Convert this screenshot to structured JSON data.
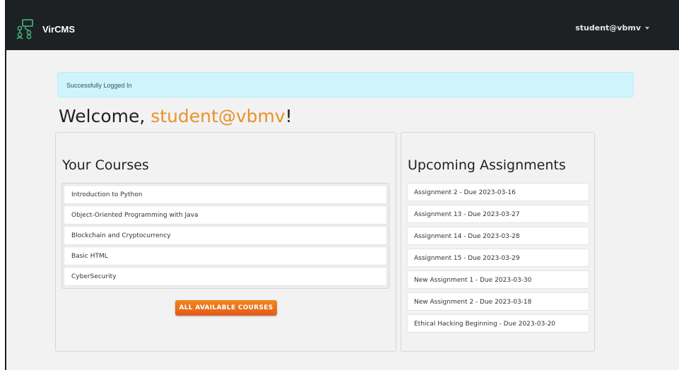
{
  "navbar": {
    "brand": "VirCMS",
    "user": "student@vbmv",
    "logo_icon": "network-nodes-icon"
  },
  "alert": {
    "message": "Successfully Logged In"
  },
  "welcome": {
    "prefix": "Welcome, ",
    "name": "student@vbmv",
    "suffix": "!"
  },
  "courses": {
    "title": "Your Courses",
    "items": [
      "Introduction to Python",
      "Object-Oriented Programming with Java",
      "Blockchain and Cryptocurrency",
      "Basic HTML",
      "CyberSecurity"
    ],
    "button_label": "ALL AVAILABLE COURSES"
  },
  "assignments": {
    "title": "Upcoming Assignments",
    "items": [
      "Assignment 2 - Due 2023-03-16",
      "Assignment 13 - Due 2023-03-27",
      "Assignment 14 - Due 2023-03-28",
      "Assignment 15 - Due 2023-03-29",
      "New Assignment 1 - Due 2023-03-30",
      "New Assignment 2 - Due 2023-03-18",
      "Ethical Hacking Beginning - Due 2023-03-20"
    ]
  },
  "colors": {
    "navbar_bg": "#1d2124",
    "alert_bg": "#cff4fc",
    "accent_name": "#e8922a",
    "button_orange": "#f08a1e",
    "button_red": "#e2581c"
  }
}
